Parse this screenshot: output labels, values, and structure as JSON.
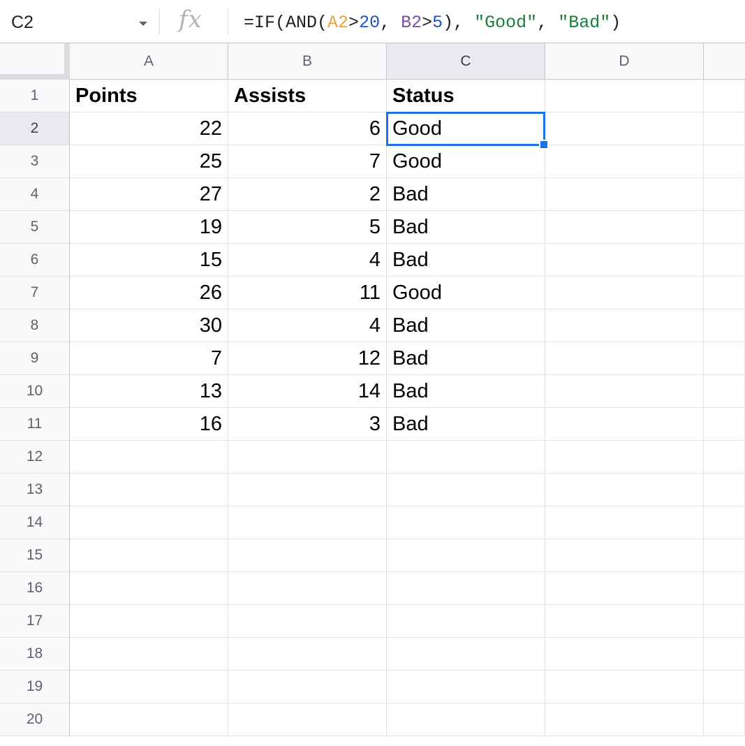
{
  "formula_bar": {
    "name_box": "C2",
    "fx_label": "fx",
    "formula": {
      "p1": "=IF(AND(",
      "ref1": "A2",
      "op1": ">",
      "num1": "20",
      "sep1": ", ",
      "ref2": "B2",
      "op2": ">",
      "num2": "5",
      "sep2": "), ",
      "str1": "\"Good\"",
      "sep3": ", ",
      "str2": "\"Bad\"",
      "p2": ")"
    }
  },
  "columns": [
    "A",
    "B",
    "C",
    "D"
  ],
  "row_numbers": [
    "1",
    "2",
    "3",
    "4",
    "5",
    "6",
    "7",
    "8",
    "9",
    "10",
    "11",
    "12",
    "13",
    "14",
    "15",
    "16",
    "17",
    "18",
    "19",
    "20"
  ],
  "rows": [
    [
      "Points",
      "Assists",
      "Status",
      ""
    ],
    [
      "22",
      "6",
      "Good",
      ""
    ],
    [
      "25",
      "7",
      "Good",
      ""
    ],
    [
      "27",
      "2",
      "Bad",
      ""
    ],
    [
      "19",
      "5",
      "Bad",
      ""
    ],
    [
      "15",
      "4",
      "Bad",
      ""
    ],
    [
      "26",
      "11",
      "Good",
      ""
    ],
    [
      "30",
      "4",
      "Bad",
      ""
    ],
    [
      "7",
      "12",
      "Bad",
      ""
    ],
    [
      "13",
      "14",
      "Bad",
      ""
    ],
    [
      "16",
      "3",
      "Bad",
      ""
    ]
  ],
  "selected_cell": "C2",
  "colors": {
    "selection": "#1a73e8",
    "header_bg": "#f8f9fa",
    "grid_line": "#e1e3e1"
  }
}
